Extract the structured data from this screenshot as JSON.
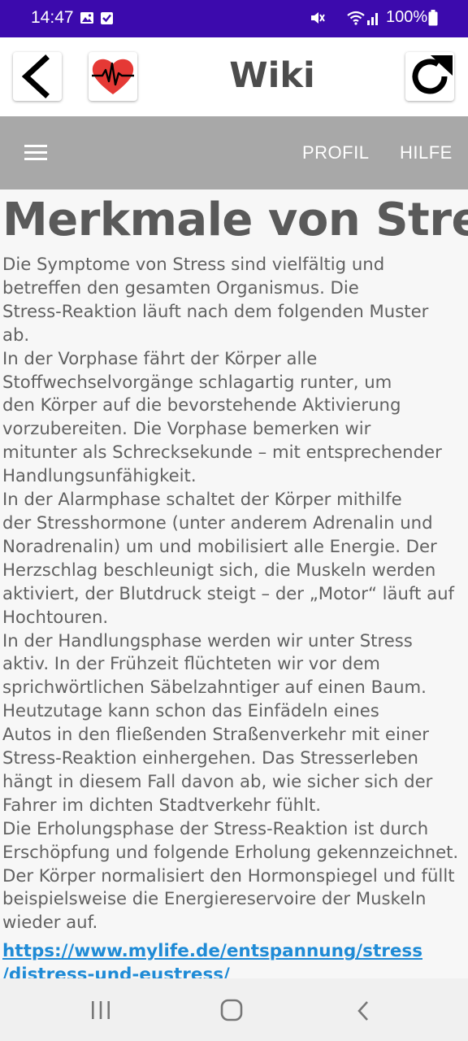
{
  "status_bar": {
    "time": "14:47",
    "battery": "100%",
    "icons": [
      "image-icon",
      "check-icon",
      "mute-icon",
      "wifi-icon",
      "signal-icon",
      "battery-icon"
    ]
  },
  "header": {
    "title": "Wiki",
    "back_icon": "back-arrow-icon",
    "heart_icon": "heart-pulse-icon",
    "reload_icon": "reload-icon"
  },
  "nav": {
    "menu_icon": "hamburger-menu-icon",
    "profil": "PROFIL",
    "hilfe": "HILFE"
  },
  "article": {
    "heading": "Merkmale von Stress",
    "lines": [
      "Die Symptome von Stress sind vielfältig und",
      "betreffen den gesamten Organismus. Die",
      "Stress-Reaktion läuft nach dem folgenden Muster",
      "ab.",
      "In der Vorphase fährt der Körper alle",
      "Stoffwechselvorgänge schlagartig runter, um",
      "den Körper auf die bevorstehende Aktivierung",
      "vorzubereiten. Die Vorphase bemerken wir",
      "mitunter als Schrecksekunde – mit entsprechender",
      "Handlungsunfähigkeit.",
      "In der Alarmphase schaltet der Körper mithilfe",
      "der Stresshormone (unter anderem Adrenalin und",
      "Noradrenalin) um und mobilisiert alle Energie. Der",
      "Herzschlag beschleunigt sich, die Muskeln werden",
      "aktiviert, der Blutdruck steigt – der „Motor“ läuft auf",
      "Hochtouren.",
      "In der Handlungsphase werden wir unter Stress",
      "aktiv. In der Frühzeit flüchteten wir vor dem",
      "sprichwörtlichen Säbelzahntiger auf einen Baum.",
      "Heutzutage kann schon das Einfädeln eines",
      "Autos in den fließenden Straßenverkehr mit einer",
      "Stress-Reaktion einhergehen. Das Stresserleben",
      "hängt in diesem Fall davon ab, wie sicher sich der",
      "Fahrer im dichten Stadtverkehr fühlt.",
      "Die Erholungsphase der Stress-Reaktion ist durch",
      "Erschöpfung und folgende Erholung gekennzeichnet.",
      "Der Körper normalisiert den Hormonspiegel und füllt",
      "beispielsweise die Energiereservoire der Muskeln",
      "wieder auf."
    ],
    "link_line1": "https://www.mylife.de/entspannung/stress",
    "link_line2": "/distress-und-eustress/"
  },
  "bottom_nav": {
    "icons": [
      "recents-icon",
      "home-icon",
      "back-icon"
    ]
  }
}
